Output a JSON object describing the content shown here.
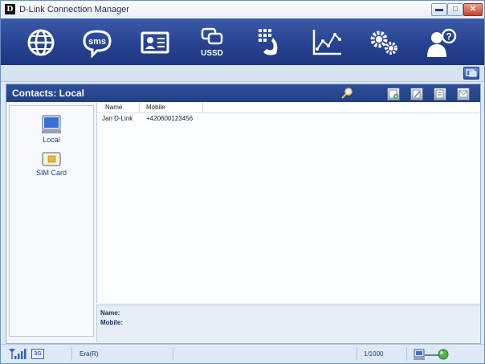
{
  "window": {
    "title": "D-Link Connection Manager",
    "logo": "D"
  },
  "window_controls": {
    "minimize": "▬",
    "maximize": "□",
    "close": "✕"
  },
  "toolbar": {
    "buttons": [
      {
        "name": "globe-icon",
        "label": ""
      },
      {
        "name": "sms-icon",
        "label": "sms"
      },
      {
        "name": "contacts-card-icon",
        "label": ""
      },
      {
        "name": "ussd-icon",
        "label": "USSD"
      },
      {
        "name": "phone-dialpad-icon",
        "label": ""
      },
      {
        "name": "statistics-chart-icon",
        "label": ""
      },
      {
        "name": "settings-gears-icon",
        "label": ""
      },
      {
        "name": "help-user-icon",
        "label": ""
      }
    ]
  },
  "contacts": {
    "header_title": "Contacts: Local",
    "nav": [
      {
        "label": "Local",
        "icon": "monitor-icon"
      },
      {
        "label": "SIM Card",
        "icon": "sim-card-icon"
      }
    ],
    "columns": [
      "Name",
      "Mobile"
    ],
    "rows": [
      {
        "name": "Jan D-Link",
        "mobile": "+420600123456"
      }
    ],
    "detail": {
      "name_label": "Name:",
      "mobile_label": "Mobile:"
    }
  },
  "status": {
    "network_type": "3G",
    "operator": "Era(R)",
    "counter": "1/1000"
  },
  "colors": {
    "toolbar": "#25418f",
    "header": "#2d4f9a",
    "accent": "#1a3f8c"
  }
}
